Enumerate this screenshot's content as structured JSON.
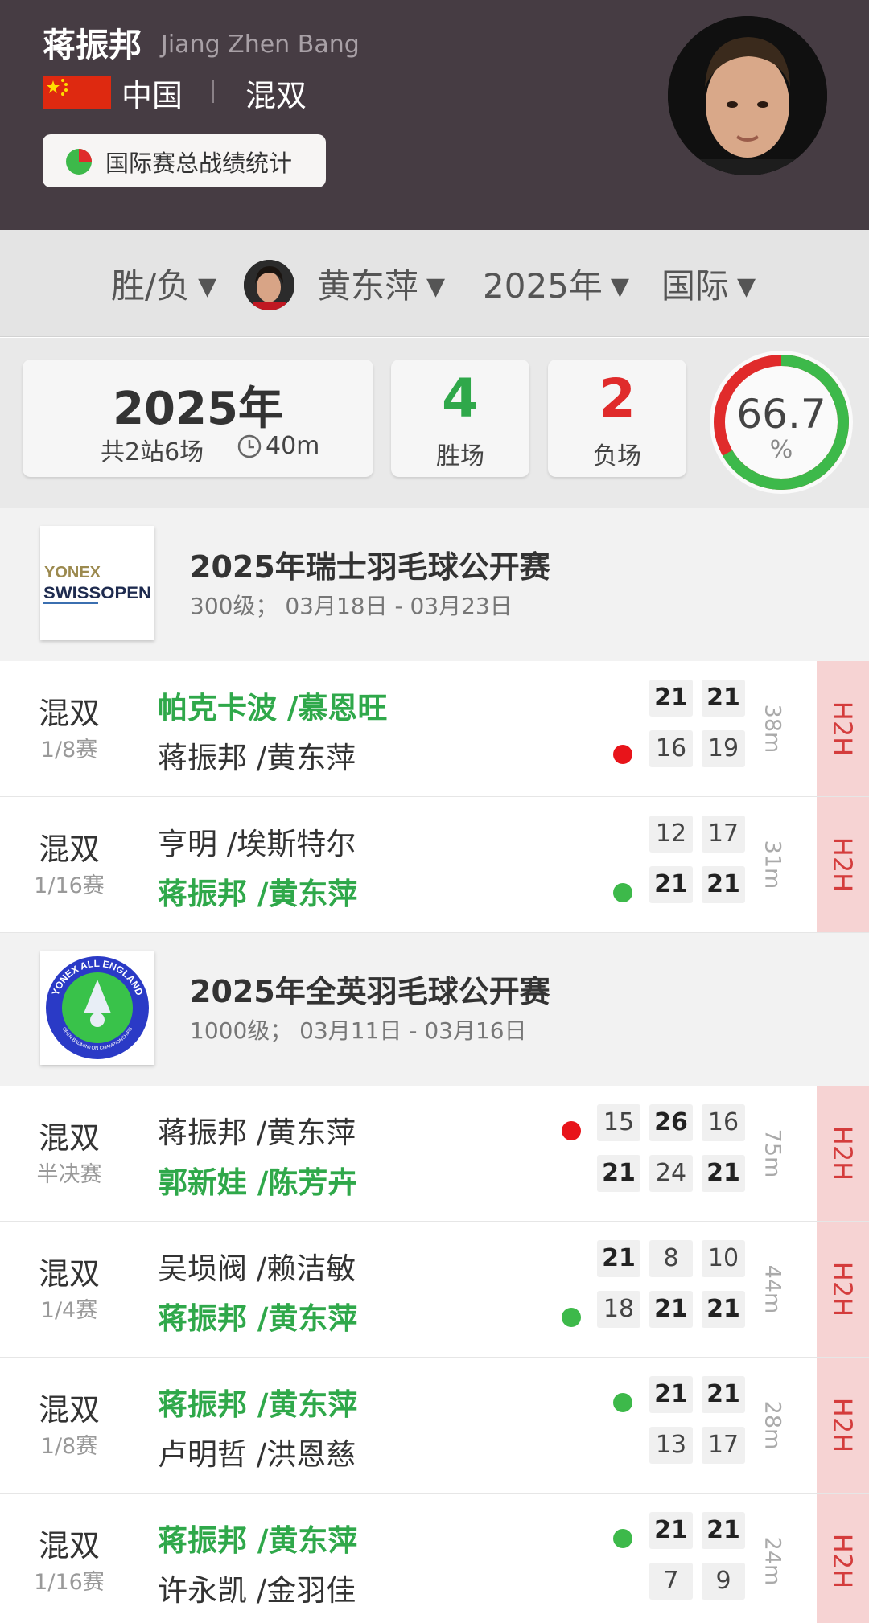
{
  "player": {
    "name_cn": "蒋振邦",
    "name_en": "Jiang Zhen Bang",
    "country": "中国",
    "event": "混双",
    "stats_button": "国际赛总战绩统计"
  },
  "filters": {
    "result": "胜/负",
    "partner": "黄东萍",
    "year": "2025年",
    "scope": "国际"
  },
  "summary": {
    "year": "2025年",
    "stations": "共2站6场",
    "duration": "40m",
    "wins": "4",
    "wins_label": "胜场",
    "losses": "2",
    "losses_label": "负场",
    "win_pct": "66.7",
    "pct_sign": "%",
    "win_fraction": 0.667
  },
  "tournaments": [
    {
      "name": "2025年瑞士羽毛球公开赛",
      "info": "300级；  03月18日 - 03月23日",
      "logo_text_1": "YONEX",
      "logo_text_2": "SWISSOPEN",
      "matches": [
        {
          "type": "混双",
          "round": "1/8赛",
          "team1": "帕克卡波 /慕恩旺",
          "team2": "蒋振邦 /黄东萍",
          "s1": [
            "21",
            "21"
          ],
          "s2": [
            "16",
            "19"
          ],
          "duration": "38m",
          "h2h": "H2H"
        },
        {
          "type": "混双",
          "round": "1/16赛",
          "team1": "亨明 /埃斯特尔",
          "team2": "蒋振邦 /黄东萍",
          "s1": [
            "12",
            "17"
          ],
          "s2": [
            "21",
            "21"
          ],
          "duration": "31m",
          "h2h": "H2H"
        }
      ]
    },
    {
      "name": "2025年全英羽毛球公开赛",
      "info": "1000级；  03月11日 - 03月16日",
      "logo_text_1": "YONEX ALL ENGLAND",
      "logo_text_2": "OPEN BADMINTON CHAMPIONSHIPS",
      "matches": [
        {
          "type": "混双",
          "round": "半决赛",
          "team1": "蒋振邦 /黄东萍",
          "team2": "郭新娃 /陈芳卉",
          "s1": [
            "15",
            "26",
            "16"
          ],
          "s2": [
            "21",
            "24",
            "21"
          ],
          "duration": "75m",
          "h2h": "H2H"
        },
        {
          "type": "混双",
          "round": "1/4赛",
          "team1": "吴埙阀 /赖洁敏",
          "team2": "蒋振邦 /黄东萍",
          "s1": [
            "21",
            "8",
            "10"
          ],
          "s2": [
            "18",
            "21",
            "21"
          ],
          "duration": "44m",
          "h2h": "H2H"
        },
        {
          "type": "混双",
          "round": "1/8赛",
          "team1": "蒋振邦 /黄东萍",
          "team2": "卢明哲 /洪恩慈",
          "s1": [
            "21",
            "21"
          ],
          "s2": [
            "13",
            "17"
          ],
          "duration": "28m",
          "h2h": "H2H"
        },
        {
          "type": "混双",
          "round": "1/16赛",
          "team1": "蒋振邦 /黄东萍",
          "team2": "许永凯 /金羽佳",
          "s1": [
            "21",
            "21"
          ],
          "s2": [
            "7",
            "9"
          ],
          "duration": "24m",
          "h2h": "H2H"
        }
      ]
    }
  ],
  "colors": {
    "header_bg": "#463c43",
    "win_green": "#2fa84a",
    "loss_red": "#e02b2b",
    "h2h_bg": "#f6d3d3",
    "h2h_text": "#d43c3c"
  }
}
